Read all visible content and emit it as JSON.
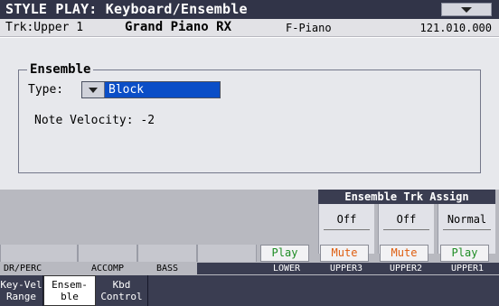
{
  "title_bar": {
    "title": "STYLE PLAY: Keyboard/Ensemble",
    "menu_icon": "triangle-down-icon"
  },
  "track_bar": {
    "track": "Trk:Upper 1",
    "sound": "Grand Piano RX",
    "category": "F-Piano",
    "bank": "121.010.000"
  },
  "ensemble": {
    "title": "Ensemble",
    "type_label": "Type:",
    "type_value": "Block",
    "note_velocity": "Note Velocity: -2"
  },
  "assign": {
    "header": "Ensemble Trk Assign",
    "values": [
      "Off",
      "Off",
      "Normal"
    ]
  },
  "track_buttons": [
    "Play",
    "Mute",
    "Mute",
    "Play"
  ],
  "track_labels": [
    "DR/PERC",
    "ACCOMP",
    "BASS",
    "",
    "LOWER",
    "UPPER3",
    "UPPER2",
    "UPPER1"
  ],
  "tabs": [
    "Key-Vel Range",
    "Ensem- ble",
    "Kbd Control"
  ]
}
